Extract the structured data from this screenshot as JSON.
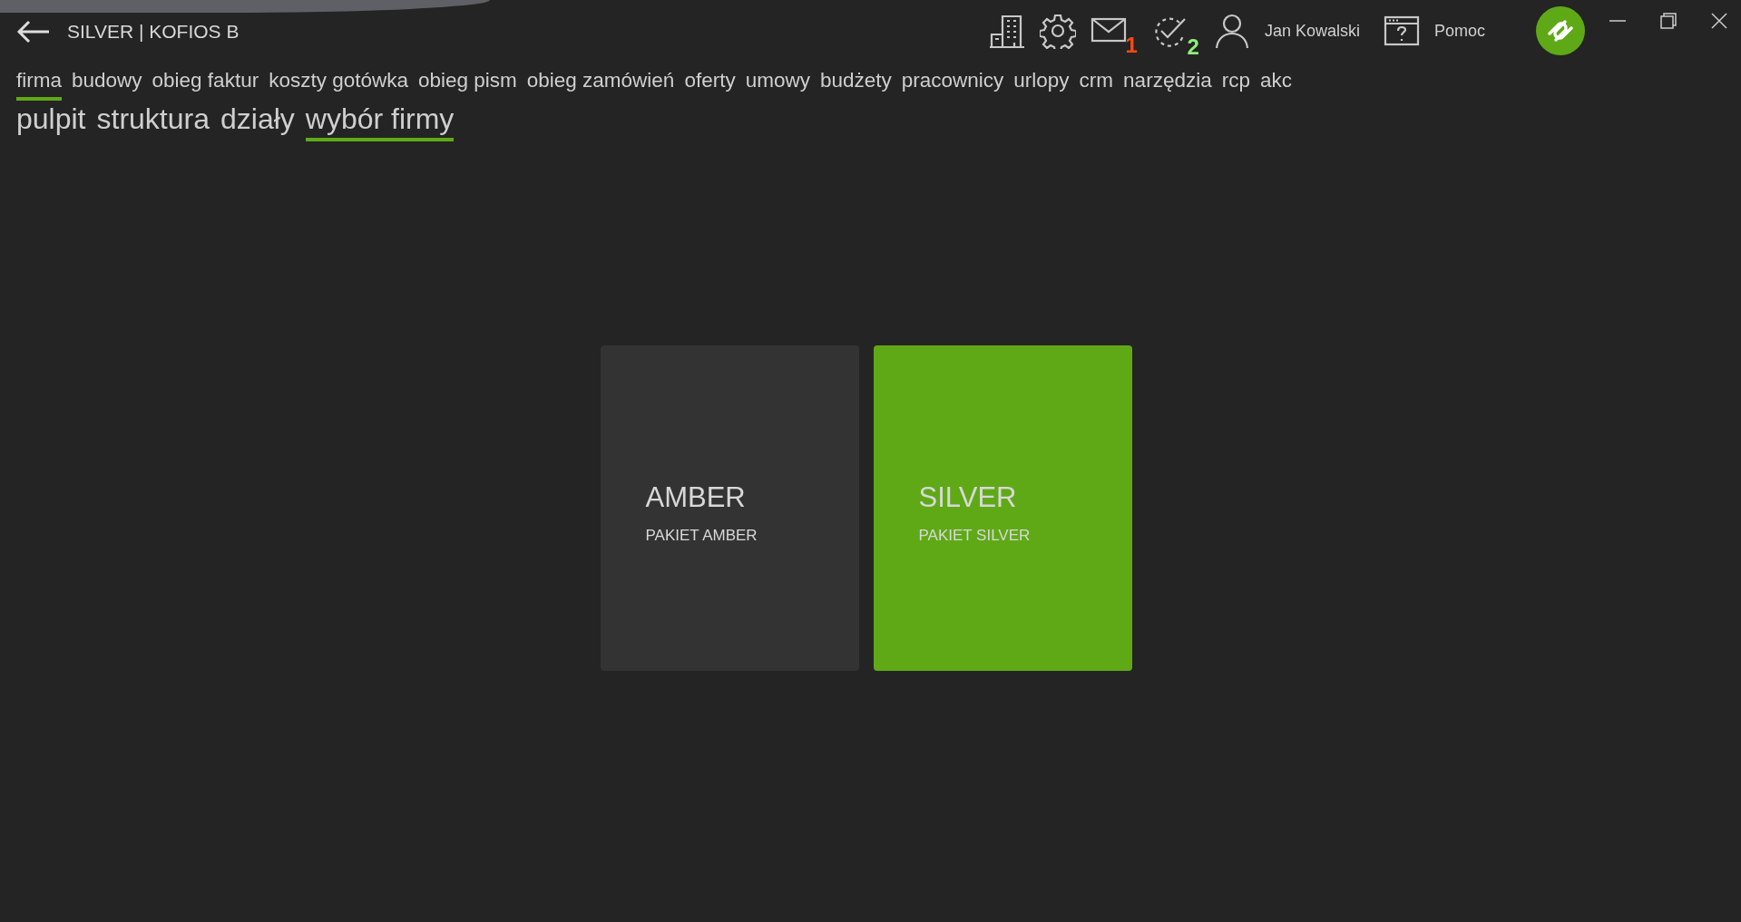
{
  "header": {
    "title": "SILVER | KOFIOS B",
    "user": "Jan Kowalski",
    "help": "Pomoc",
    "badges": [
      {
        "kind": "mail",
        "count": "1",
        "color": "#ff4a12"
      },
      {
        "kind": "tasks",
        "count": "2",
        "color": "#8cf07a"
      }
    ]
  },
  "modules": [
    {
      "label": "firma",
      "selected": true
    },
    {
      "label": "budowy",
      "selected": false
    },
    {
      "label": "obieg faktur",
      "selected": false
    },
    {
      "label": "koszty gotówka",
      "selected": false
    },
    {
      "label": "obieg pism",
      "selected": false
    },
    {
      "label": "obieg zamówień",
      "selected": false
    },
    {
      "label": "oferty",
      "selected": false
    },
    {
      "label": "umowy",
      "selected": false
    },
    {
      "label": "budżety",
      "selected": false
    },
    {
      "label": "pracownicy",
      "selected": false
    },
    {
      "label": "urlopy",
      "selected": false
    },
    {
      "label": "crm",
      "selected": false
    },
    {
      "label": "narzędzia",
      "selected": false
    },
    {
      "label": "rcp",
      "selected": false
    },
    {
      "label": "akc",
      "selected": false
    }
  ],
  "sections": [
    {
      "label": "pulpit",
      "selected": false
    },
    {
      "label": "struktura",
      "selected": false
    },
    {
      "label": "działy",
      "selected": false
    },
    {
      "label": "wybór firmy",
      "selected": true
    }
  ],
  "companies": [
    {
      "name": "AMBER",
      "package": "PAKIET AMBER",
      "selected": false
    },
    {
      "name": "SILVER",
      "package": "PAKIET SILVER",
      "selected": true
    }
  ]
}
